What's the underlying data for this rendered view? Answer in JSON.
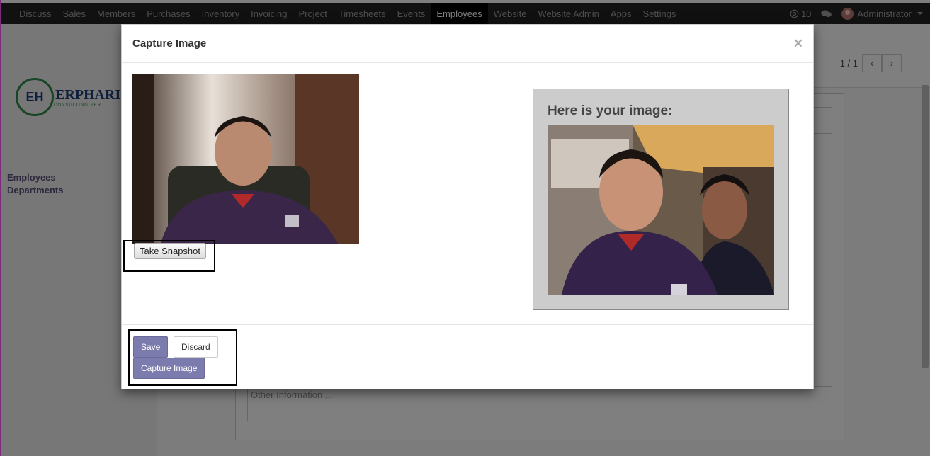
{
  "nav": {
    "items": [
      "Discuss",
      "Sales",
      "Members",
      "Purchases",
      "Inventory",
      "Invoicing",
      "Project",
      "Timesheets",
      "Events",
      "Employees",
      "Website",
      "Website Admin",
      "Apps",
      "Settings"
    ],
    "active": "Employees",
    "notifications": "10",
    "user": "Administrator"
  },
  "background": {
    "brand": "ERPHARI",
    "brand_sub": "CONSULTING SER",
    "logo_initials": "EH",
    "side_links": [
      "Employees",
      "Departments"
    ],
    "pager": "1 / 1",
    "other_info_placeholder": "Other Information ..."
  },
  "modal": {
    "title": "Capture Image",
    "close": "×",
    "take_snapshot": "Take Snapshot",
    "result_heading": "Here is your image:",
    "save": "Save",
    "discard": "Discard",
    "capture": "Capture Image"
  },
  "icons": {
    "close": "close-icon",
    "prev": "chevron-left-icon",
    "next": "chevron-right-icon",
    "mention": "at-icon",
    "chat": "chat-icon"
  }
}
